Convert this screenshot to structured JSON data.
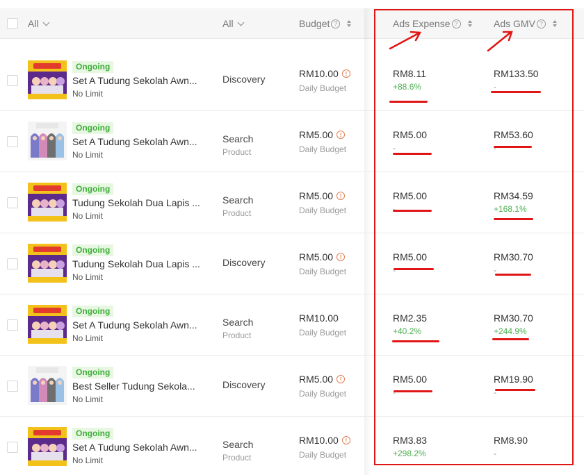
{
  "header": {
    "filter_all_1": "All",
    "filter_all_2": "All",
    "budget": "Budget",
    "ads_expense": "Ads Expense",
    "ads_gmv": "Ads GMV"
  },
  "colors": {
    "annotation": "#e01515",
    "positive": "#4caf50",
    "status_badge": "#3fae3a"
  },
  "rows": [
    {
      "status": "Ongoing",
      "name": "Set A Tudung Sekolah Awn...",
      "limit": "No Limit",
      "ad_type": "Discovery",
      "ad_sub": "",
      "budget": "RM10.00",
      "budget_info": true,
      "budget_type": "Daily Budget",
      "expense": "RM8.11",
      "expense_change": "+88.6%",
      "gmv": "RM133.50",
      "gmv_change": "-",
      "thumb": "sale"
    },
    {
      "status": "Ongoing",
      "name": "Set A Tudung Sekolah Awn...",
      "limit": "No Limit",
      "ad_type": "Search",
      "ad_sub": "Product",
      "budget": "RM5.00",
      "budget_info": true,
      "budget_type": "Daily Budget",
      "expense": "RM5.00",
      "expense_change": "-",
      "gmv": "RM53.60",
      "gmv_change": "-",
      "thumb": "white"
    },
    {
      "status": "Ongoing",
      "name": "Tudung Sekolah Dua Lapis ...",
      "limit": "No Limit",
      "ad_type": "Search",
      "ad_sub": "Product",
      "budget": "RM5.00",
      "budget_info": true,
      "budget_type": "Daily Budget",
      "expense": "RM5.00",
      "expense_change": "-",
      "gmv": "RM34.59",
      "gmv_change": "+168.1%",
      "thumb": "sale"
    },
    {
      "status": "Ongoing",
      "name": "Tudung Sekolah Dua Lapis ...",
      "limit": "No Limit",
      "ad_type": "Discovery",
      "ad_sub": "",
      "budget": "RM5.00",
      "budget_info": true,
      "budget_type": "Daily Budget",
      "expense": "RM5.00",
      "expense_change": "-",
      "gmv": "RM30.70",
      "gmv_change": "-",
      "thumb": "sale"
    },
    {
      "status": "Ongoing",
      "name": "Set A Tudung Sekolah Awn...",
      "limit": "No Limit",
      "ad_type": "Search",
      "ad_sub": "Product",
      "budget": "RM10.00",
      "budget_info": false,
      "budget_type": "Daily Budget",
      "expense": "RM2.35",
      "expense_change": "+40.2%",
      "gmv": "RM30.70",
      "gmv_change": "+244.9%",
      "thumb": "sale"
    },
    {
      "status": "Ongoing",
      "name": "Best Seller Tudung Sekola...",
      "limit": "No Limit",
      "ad_type": "Discovery",
      "ad_sub": "",
      "budget": "RM5.00",
      "budget_info": true,
      "budget_type": "Daily Budget",
      "expense": "RM5.00",
      "expense_change": "-",
      "gmv": "RM19.90",
      "gmv_change": "-",
      "thumb": "white"
    },
    {
      "status": "Ongoing",
      "name": "Set A Tudung Sekolah Awn...",
      "limit": "No Limit",
      "ad_type": "Search",
      "ad_sub": "Product",
      "budget": "RM10.00",
      "budget_info": true,
      "budget_type": "Daily Budget",
      "expense": "RM3.83",
      "expense_change": "+298.2%",
      "gmv": "RM8.90",
      "gmv_change": "-",
      "thumb": "sale"
    }
  ]
}
